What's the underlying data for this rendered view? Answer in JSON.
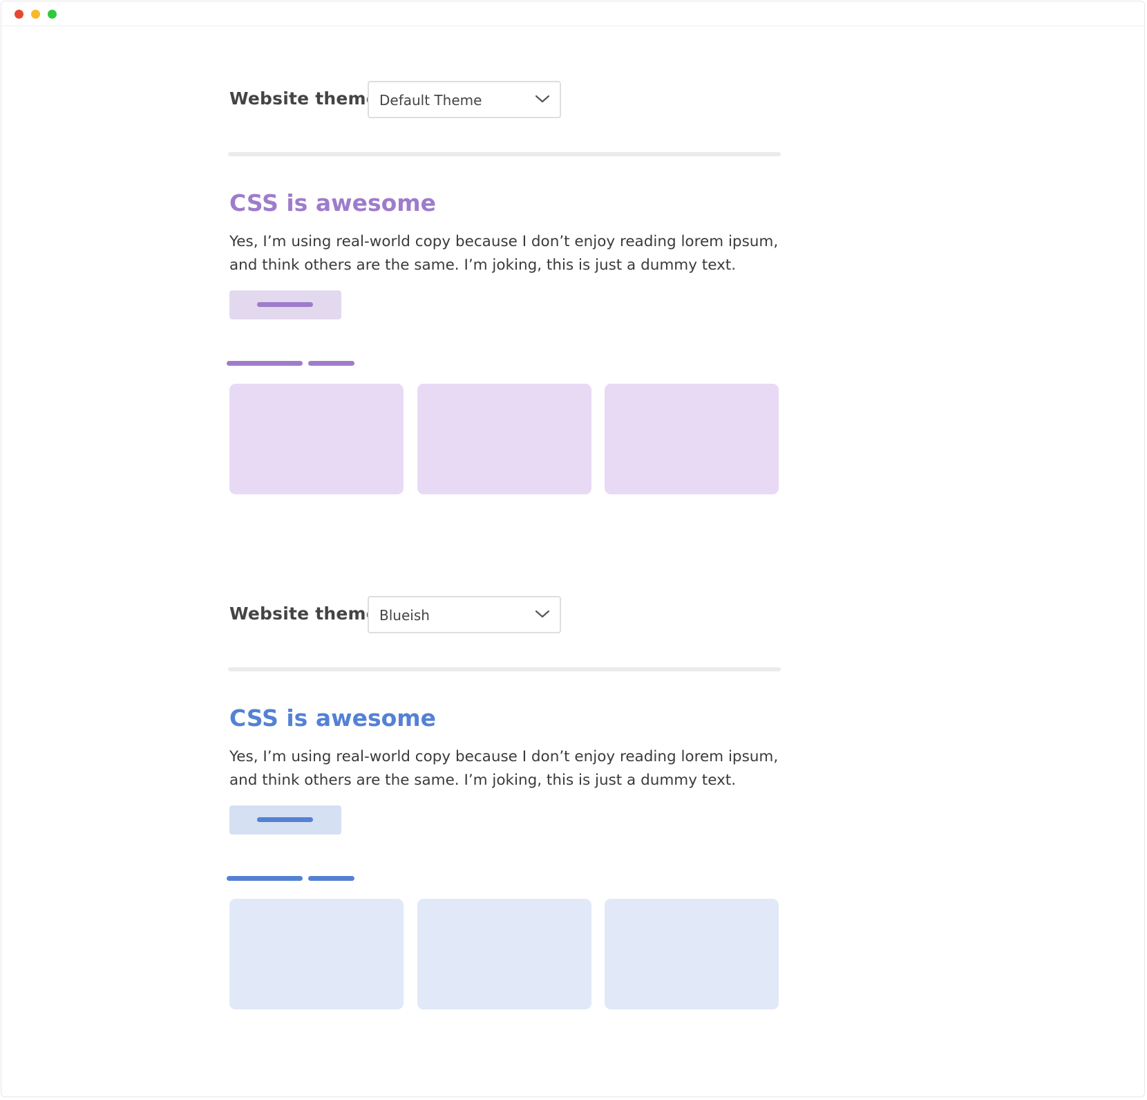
{
  "window": {
    "controls": [
      {
        "name": "close",
        "color": "#e4492f"
      },
      {
        "name": "minimize",
        "color": "#f7b928"
      },
      {
        "name": "zoom",
        "color": "#30c940"
      }
    ]
  },
  "sections": [
    {
      "theme_label": "Website theme",
      "selected_theme": "Default Theme",
      "chevron_icon": "chevron-down-icon",
      "headline": "CSS is awesome",
      "body_text": "Yes, I’m using real-world copy because I don’t enjoy reading lorem ipsum,\nand think others are the same. I’m joking, this is just a dummy text.",
      "colors": {
        "accent": "#9e7ccb",
        "button_bg": "#e3d9ef",
        "card_bg": "#e8daf5"
      }
    },
    {
      "theme_label": "Website theme",
      "selected_theme": "Blueish",
      "chevron_icon": "chevron-down-icon",
      "headline": "CSS is awesome",
      "body_text": "Yes, I’m using real-world copy because I don’t enjoy reading lorem ipsum,\nand think others are the same. I’m joking, this is just a dummy text.",
      "colors": {
        "accent": "#5481d4",
        "button_bg": "#d6e0f3",
        "card_bg": "#e1e9f8"
      }
    }
  ]
}
